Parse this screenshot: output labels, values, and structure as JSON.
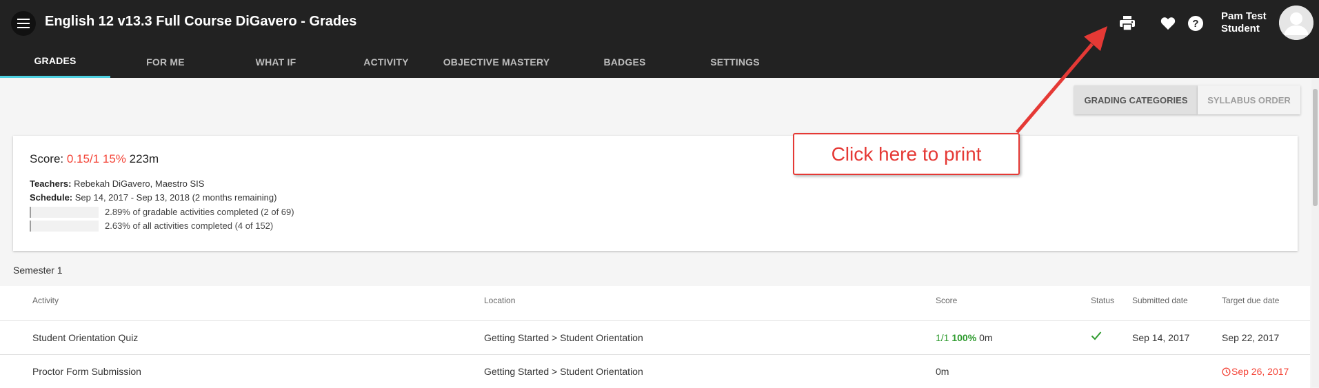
{
  "header": {
    "title": "English 12 v13.3 Full Course DiGavero - Grades",
    "user_line1": "Pam Test",
    "user_line2": "Student",
    "icons": [
      "menu-icon",
      "print-icon",
      "heart-icon",
      "help-icon",
      "avatar"
    ]
  },
  "tabs": [
    {
      "label": "GRADES",
      "active": true
    },
    {
      "label": "FOR ME"
    },
    {
      "label": "WHAT IF"
    },
    {
      "label": "ACTIVITY"
    },
    {
      "label": "OBJECTIVE MASTERY"
    },
    {
      "label": "BADGES"
    },
    {
      "label": "SETTINGS"
    }
  ],
  "view_toggle": {
    "grading_categories": "GRADING CATEGORIES",
    "syllabus_order": "SYLLABUS ORDER",
    "selected": "grading_categories"
  },
  "summary": {
    "score_label": "Score:",
    "score_value": "0.15/1",
    "score_percent": "15%",
    "score_time": "223m",
    "teachers_label": "Teachers:",
    "teachers": "Rebekah DiGavero, Maestro SIS",
    "schedule_label": "Schedule:",
    "schedule": "Sep 14, 2017 - Sep 13, 2018 (2 months remaining)",
    "progress": [
      {
        "label": "2.89% of gradable activities completed (2 of 69)",
        "percent": 2.89
      },
      {
        "label": "2.63% of all activities completed (4 of 152)",
        "percent": 2.63
      }
    ]
  },
  "semester_label": "Semester 1",
  "table": {
    "headers": {
      "activity": "Activity",
      "location": "Location",
      "score": "Score",
      "status": "Status",
      "submitted": "Submitted date",
      "target": "Target due date"
    },
    "rows": [
      {
        "activity": "Student Orientation Quiz",
        "location": "Getting Started > Student Orientation",
        "score_fraction": "1/1",
        "score_percent": "100%",
        "score_time": "0m",
        "status_icon": "check-icon",
        "submitted": "Sep 14, 2017",
        "target": "Sep 22, 2017"
      },
      {
        "activity": "Proctor Form Submission",
        "location": "Getting Started > Student Orientation",
        "score_time": "0m",
        "submitted": "",
        "target": "Sep 26, 2017",
        "target_overdue": true
      }
    ]
  },
  "annotation": {
    "callout_text": "Click here to print"
  },
  "colors": {
    "topbar": "#222222",
    "tab_indicator": "#4dd0e1",
    "score_red": "#f44336",
    "score_green": "#2e9b2e",
    "callout_red": "#e53935"
  }
}
